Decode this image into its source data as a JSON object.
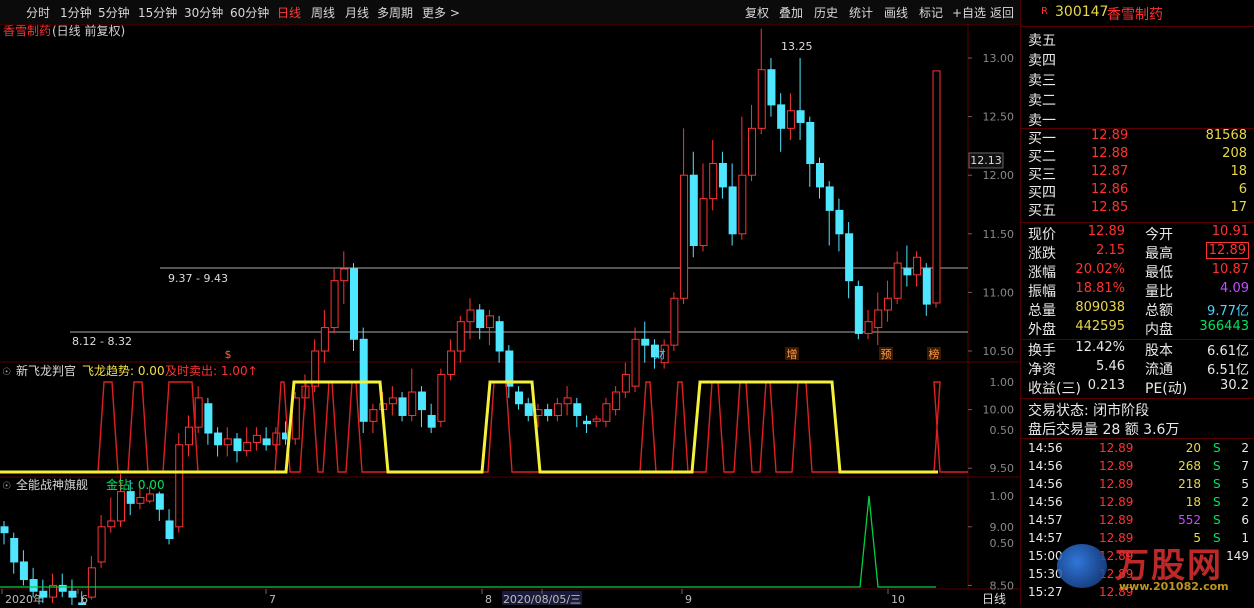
{
  "toolbar": {
    "periods": [
      "分时",
      "1分钟",
      "5分钟",
      "15分钟",
      "30分钟",
      "60分钟",
      "日线",
      "周线",
      "月线",
      "多周期",
      "更多 >"
    ],
    "active_period": "日线",
    "actions": [
      "复权",
      "叠加",
      "历史",
      "统计",
      "画线",
      "标记",
      "+自选",
      "返回"
    ]
  },
  "main_chart": {
    "title": "香雪制药",
    "subtitle": "(日线 前复权)",
    "y_ticks": [
      "13.00",
      "12.50",
      "12.00",
      "11.50",
      "11.00",
      "10.50",
      "10.00",
      "9.50",
      "9.00",
      "8.50"
    ],
    "current_price_label": "12.13",
    "high_annotation": "13.25",
    "range_label_1": "9.37 - 9.43",
    "range_label_2": "8.12 - 8.32",
    "event_markers": [
      "$",
      "财",
      "增",
      "预",
      "榜"
    ]
  },
  "indicator1": {
    "name": "新飞龙判官",
    "line1_label": "飞龙趋势:",
    "line1_value": "0.00",
    "line2_label": "及时卖出:",
    "line2_value": "1.00↑",
    "y_ticks": [
      "1.00",
      "0.50"
    ]
  },
  "indicator2": {
    "name": "全能战神旗舰",
    "line1_label": "金钻:",
    "line1_value": "0.00",
    "y_ticks": [
      "1.00",
      "0.50"
    ]
  },
  "x_axis": {
    "labels": [
      "2020年",
      "6",
      "7",
      "8",
      "2020/08/05/三",
      "9",
      "10"
    ],
    "period_label": "日线"
  },
  "stock": {
    "code": "300147",
    "name": "香雪制药",
    "badge": "R"
  },
  "order_book": {
    "asks": [
      "卖五",
      "卖四",
      "卖三",
      "卖二",
      "卖一"
    ],
    "bids": [
      {
        "label": "买一",
        "price": "12.89",
        "vol": "81568"
      },
      {
        "label": "买二",
        "price": "12.88",
        "vol": "208"
      },
      {
        "label": "买三",
        "price": "12.87",
        "vol": "18"
      },
      {
        "label": "买四",
        "price": "12.86",
        "vol": "6"
      },
      {
        "label": "买五",
        "price": "12.85",
        "vol": "17"
      }
    ]
  },
  "quote": [
    {
      "l1": "现价",
      "v1": "12.89",
      "l2": "今开",
      "v2": "10.91"
    },
    {
      "l1": "涨跌",
      "v1": "2.15",
      "l2": "最高",
      "v2": "12.89"
    },
    {
      "l1": "涨幅",
      "v1": "20.02%",
      "l2": "最低",
      "v2": "10.87"
    },
    {
      "l1": "振幅",
      "v1": "18.81%",
      "l2": "量比",
      "v2": "4.09"
    },
    {
      "l1": "总量",
      "v1": "809038",
      "l2": "总额",
      "v2": "9.77亿"
    },
    {
      "l1": "外盘",
      "v1": "442595",
      "l2": "内盘",
      "v2": "366443"
    }
  ],
  "fundamentals": [
    {
      "l1": "换手",
      "v1": "12.42%",
      "l2": "股本",
      "v2": "6.61亿"
    },
    {
      "l1": "净资",
      "v1": "5.46",
      "l2": "流通",
      "v2": "6.51亿"
    },
    {
      "l1": "收益(三)",
      "v1": "0.213",
      "l2": "PE(动)",
      "v2": "30.2"
    }
  ],
  "status": {
    "line1": "交易状态: 闭市阶段",
    "line2": "盘后交易量 28 额 3.6万"
  },
  "trades": [
    {
      "time": "14:56",
      "price": "12.89",
      "vol": "20",
      "dir": "S",
      "n": "2"
    },
    {
      "time": "14:56",
      "price": "12.89",
      "vol": "268",
      "dir": "S",
      "n": "7"
    },
    {
      "time": "14:56",
      "price": "12.89",
      "vol": "218",
      "dir": "S",
      "n": "5"
    },
    {
      "time": "14:56",
      "price": "12.89",
      "vol": "18",
      "dir": "S",
      "n": "2"
    },
    {
      "time": "14:57",
      "price": "12.89",
      "vol": "552",
      "dir": "S",
      "n": "6"
    },
    {
      "time": "14:57",
      "price": "12.89",
      "vol": "5",
      "dir": "S",
      "n": "1"
    },
    {
      "time": "15:00",
      "price": "12.89",
      "vol": "",
      "dir": "",
      "n": "149"
    },
    {
      "time": "15:30",
      "price": "12.89",
      "vol": "",
      "dir": "",
      "n": ""
    },
    {
      "time": "15:27",
      "price": "12.89",
      "vol": "",
      "dir": "",
      "n": ""
    }
  ],
  "watermark": {
    "text": "万股网",
    "url": "www.201082.com"
  },
  "colors": {
    "up": "#ff3232",
    "down": "#4fe6ff",
    "ind_red": "#e02020",
    "ind_yellow": "#f5f03a",
    "ind_green": "#00d040"
  }
}
